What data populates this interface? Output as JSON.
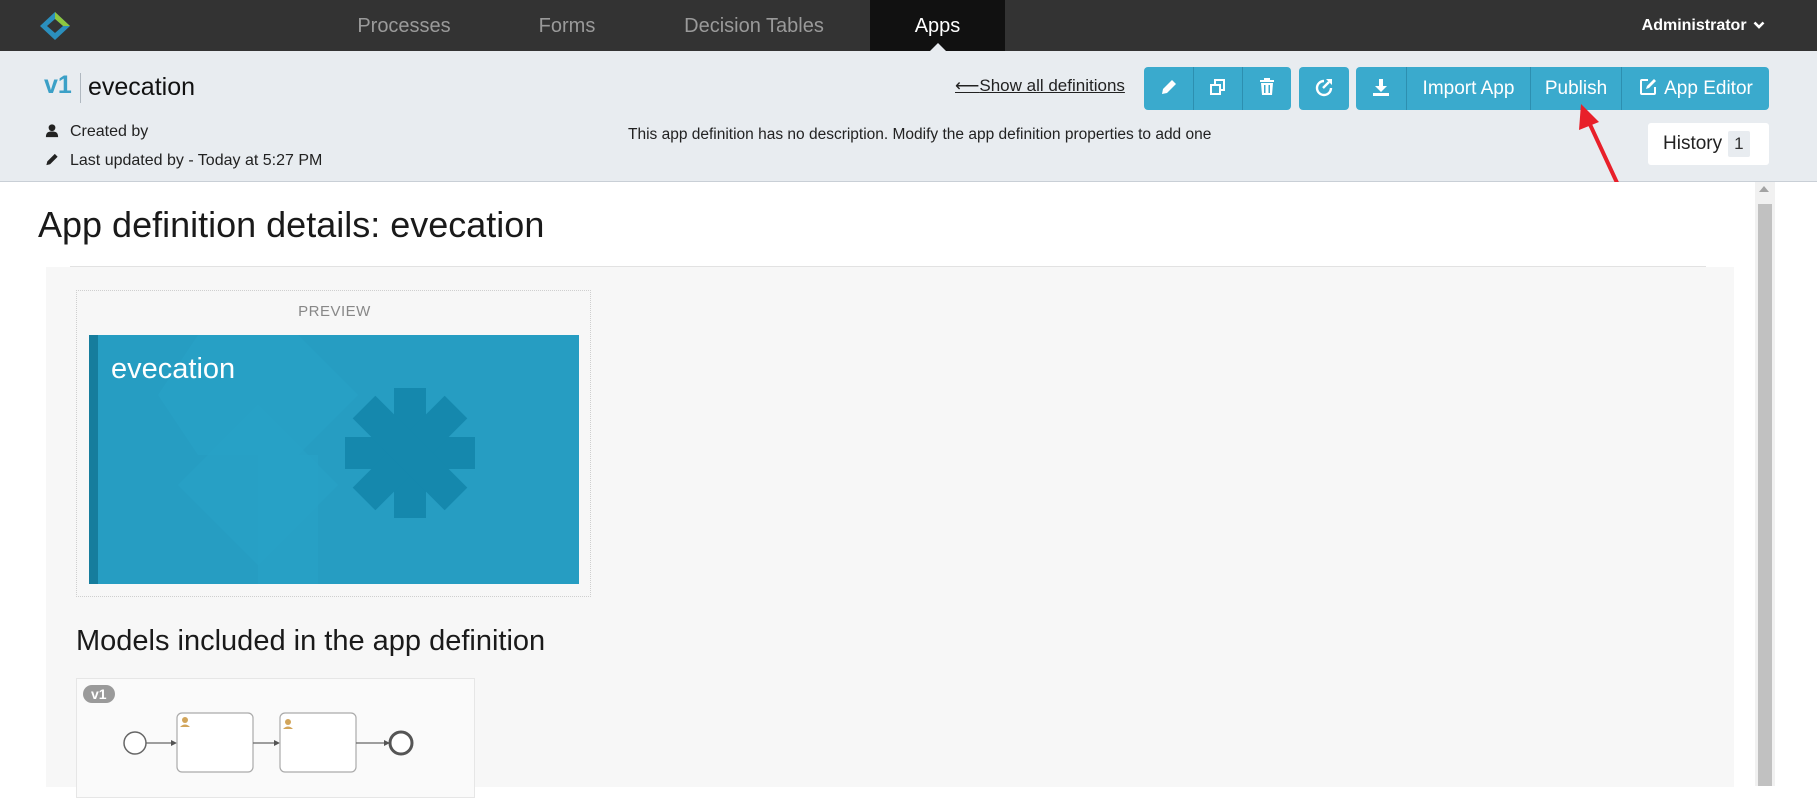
{
  "nav": {
    "items": [
      {
        "label": "Processes"
      },
      {
        "label": "Forms"
      },
      {
        "label": "Decision Tables"
      },
      {
        "label": "Apps"
      }
    ],
    "user": "Administrator"
  },
  "header": {
    "version": "v1",
    "app_name": "evecation",
    "created_by": "Created by",
    "last_updated": "Last updated by - Today at 5:27 PM",
    "description": "This app definition has no description. Modify the app definition properties to add one",
    "show_all": "Show all definitions",
    "buttons": {
      "import": "Import App",
      "publish": "Publish",
      "app_editor": "App Editor"
    },
    "history_label": "History",
    "history_count": "1"
  },
  "main": {
    "title": "App definition details: evecation",
    "preview_label": "PREVIEW",
    "tile_name": "evecation",
    "models_title": "Models included in the app definition",
    "model_version": "v1"
  },
  "colors": {
    "accent": "#3aaacd",
    "navbar": "#333333",
    "tile": "#269dc2",
    "arrow": "#e8202a"
  }
}
